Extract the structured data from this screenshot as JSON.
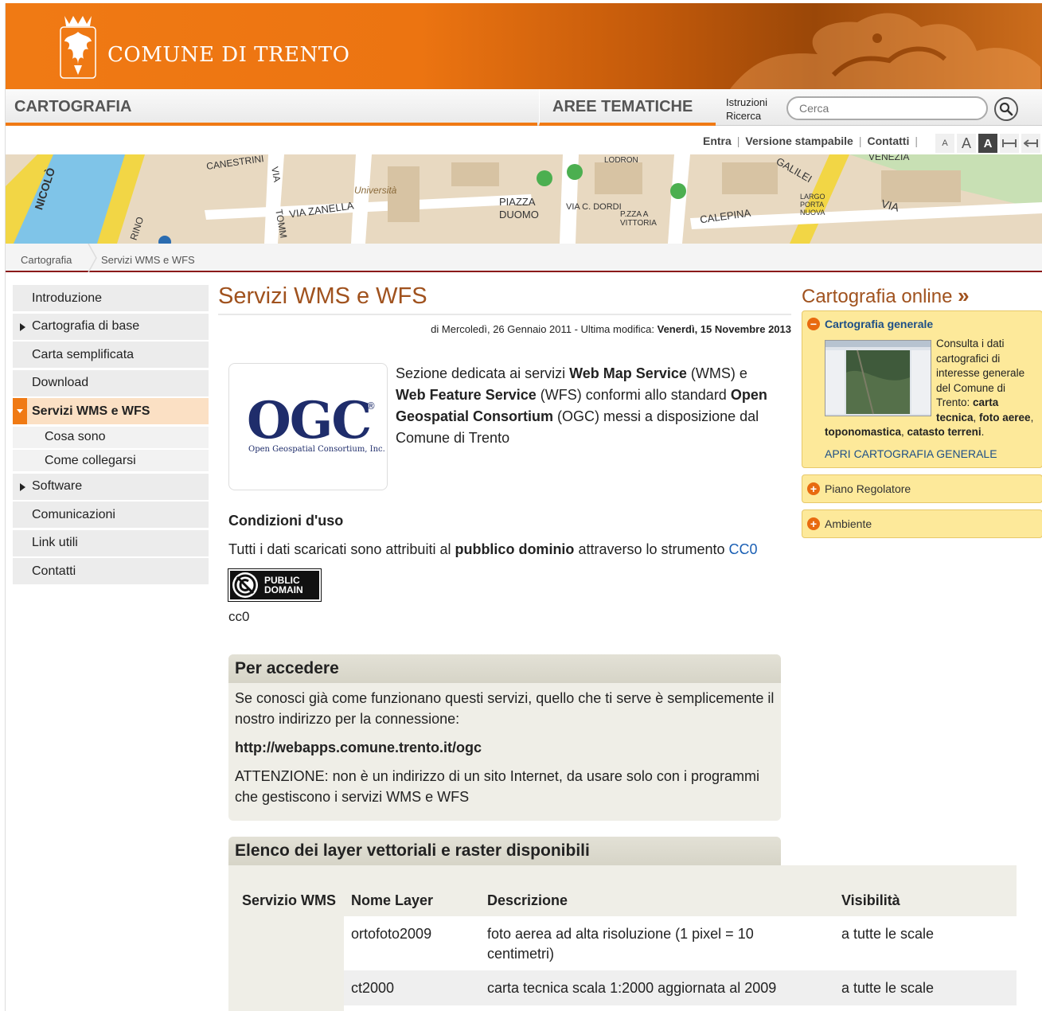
{
  "header": {
    "city_name": "COMUNE DI TRENTO"
  },
  "nav": {
    "section": "CARTOGRAFIA",
    "topic": "AREE TEMATICHE",
    "search_help_line1": "Istruzioni",
    "search_help_line2": "Ricerca",
    "search_placeholder": "Cerca"
  },
  "utility": {
    "login": "Entra",
    "print": "Versione stampabile",
    "contacts": "Contatti",
    "font_sizes": [
      "A",
      "A",
      "A"
    ]
  },
  "map_labels": [
    "NICOLÒ",
    "CANESTRINI",
    "VIA",
    "VIA ZANELLA",
    "Università",
    "PIAZZA",
    "DUOMO",
    "VIA C. DORDI",
    "LODRON",
    "P.ZZA A VITTORIA",
    "CALEPINA",
    "GALILEI",
    "LARGO PORTA NUOVA",
    "VIA",
    "VENEZIA",
    "TOMM",
    "RINO"
  ],
  "breadcrumb": [
    "Cartografia",
    "Servizi WMS e WFS"
  ],
  "sidebar": {
    "items": [
      {
        "label": "Introduzione"
      },
      {
        "label": "Cartografia di base"
      },
      {
        "label": "Carta semplificata"
      },
      {
        "label": "Download"
      },
      {
        "label": "Servizi WMS e WFS"
      },
      {
        "label": "Cosa sono"
      },
      {
        "label": "Come collegarsi"
      },
      {
        "label": "Software"
      },
      {
        "label": "Comunicazioni"
      },
      {
        "label": "Link utili"
      },
      {
        "label": "Contatti"
      }
    ]
  },
  "main": {
    "title": "Servizi WMS e WFS",
    "meta_prefix": "di Mercoledì, 26 Gennaio 2011 - Ultima modifica: ",
    "meta_modified": "Venerdì, 15 Novembre 2013",
    "ogc_logo_big": "OGC",
    "ogc_logo_reg": "®",
    "ogc_logo_small": "Open Geospatial Consortium, Inc.",
    "intro": {
      "t1": "Sezione dedicata ai servizi ",
      "b1": "Web Map Service",
      "t2": " (WMS) e ",
      "b2": "Web Feature Service",
      "t3": " (WFS) conformi allo standard ",
      "b3": "Open Geospatial Consortium",
      "t4": " (OGC) messi a disposizione dal Comune di Trento"
    },
    "conditions": {
      "title": "Condizioni d'uso",
      "t1": "Tutti i dati scaricati sono attribuiti al ",
      "b1": "pubblico dominio",
      "t2": " attraverso lo strumento ",
      "link": "CC0",
      "badge_line1": "PUBLIC",
      "badge_line2": "DOMAIN",
      "caption": "cc0"
    },
    "access": {
      "title": "Per accedere",
      "p1": "Se conosci già come funzionano questi servizi, quello che ti serve è semplicemente il nostro indirizzo per la connessione:",
      "url": "http://webapps.comune.trento.it/ogc",
      "p2": "ATTENZIONE: non è un indirizzo di un sito Internet, da usare solo con i programmi che gestiscono i servizi WMS e WFS"
    },
    "layers": {
      "title": "Elenco dei layer vettoriali e raster disponibili",
      "headers": [
        "Servizio WMS",
        "Nome Layer",
        "Descrizione",
        "Visibilità"
      ],
      "rows": [
        {
          "name": "ortofoto2009",
          "description": "foto aerea ad alta risoluzione (1 pixel = 10 centimetri)",
          "visibility": "a tutte le scale"
        },
        {
          "name": "ct2000",
          "description": "carta tecnica scala 1:2000 aggiornata al 2009",
          "visibility": "a tutte le scale"
        }
      ]
    }
  },
  "right": {
    "title": "Cartografia online",
    "title_arrow": "»",
    "boxes": {
      "general": {
        "title": "Cartografia generale",
        "t1": "Consulta i dati cartografici di interesse generale del Comune di Trento: ",
        "b1": "carta tecnica",
        "t2": ", ",
        "b2": "foto aeree",
        "t3": ", ",
        "b3": "toponomastica",
        "t4": ", ",
        "b4": "catasto terreni",
        "t5": ".",
        "link": "APRI CARTOGRAFIA GENERALE"
      },
      "plan": {
        "title": "Piano Regolatore"
      },
      "env": {
        "title": "Ambiente"
      }
    }
  },
  "colors": {
    "accent_orange": "#f07a14",
    "title_brown": "#a0521e",
    "link_blue": "#1a5fb4",
    "sidebar_active": "#fbe0c4"
  }
}
